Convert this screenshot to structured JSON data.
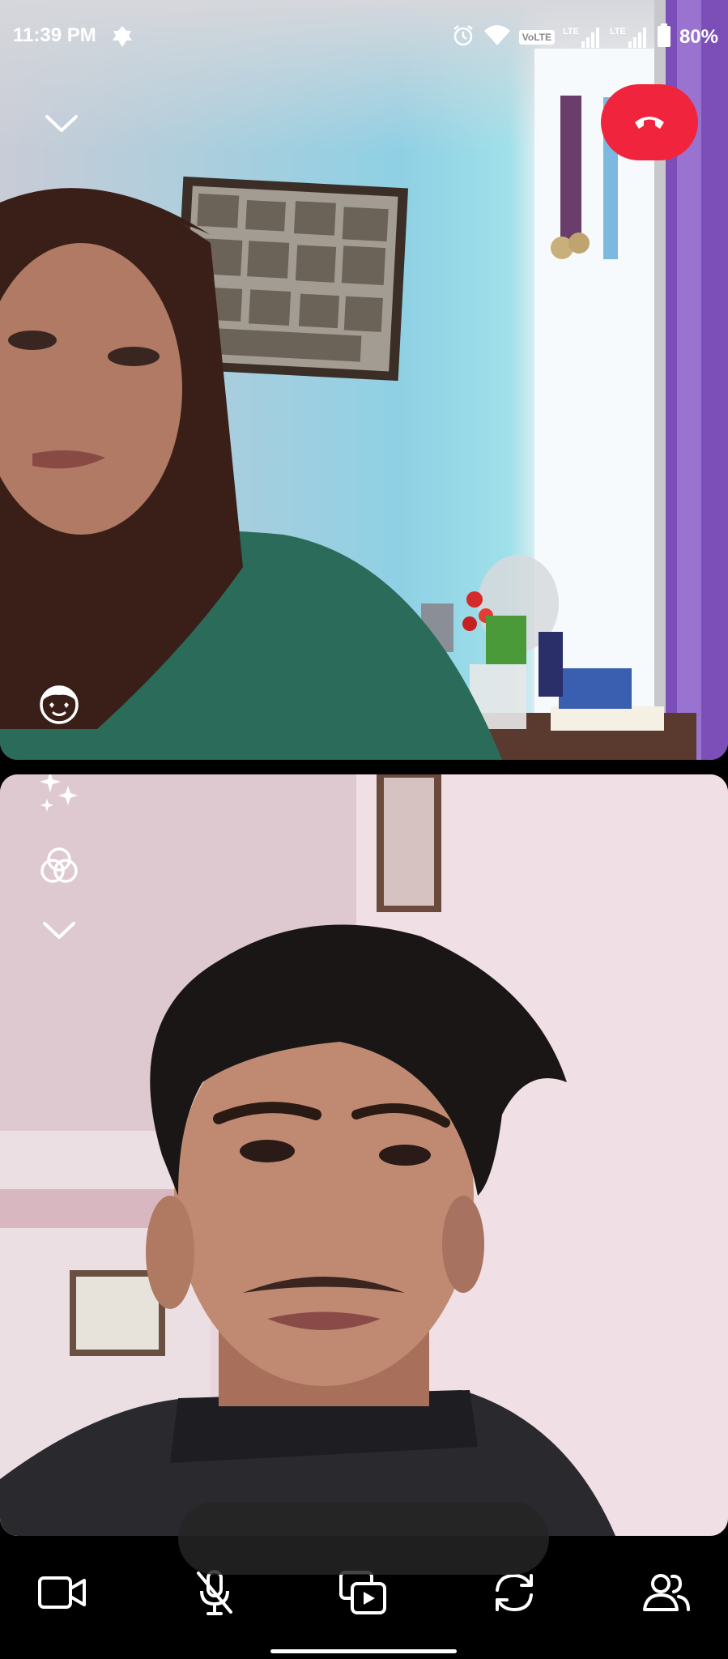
{
  "status_bar": {
    "time": "11:39 PM",
    "left_icon": "bug-notification-icon",
    "icons": [
      "alarm-icon",
      "wifi-icon",
      "volte-icon",
      "lte-signal-icon",
      "lte-signal-icon"
    ],
    "volte_label": "VoLTE",
    "lte_label": "LTE",
    "battery_percent": "80%"
  },
  "remote_video": {
    "collapse_icon": "chevron-down-icon",
    "end_call_icon": "phone-hangup-icon",
    "end_call_color": "#f0253d"
  },
  "effects_rail": {
    "items": [
      "face-filter-icon",
      "sparkles-icon",
      "color-filter-icon",
      "chevron-down-icon"
    ]
  },
  "controls": {
    "items": [
      "video-camera-icon",
      "microphone-muted-icon",
      "media-share-icon",
      "switch-camera-icon",
      "participants-icon"
    ]
  }
}
